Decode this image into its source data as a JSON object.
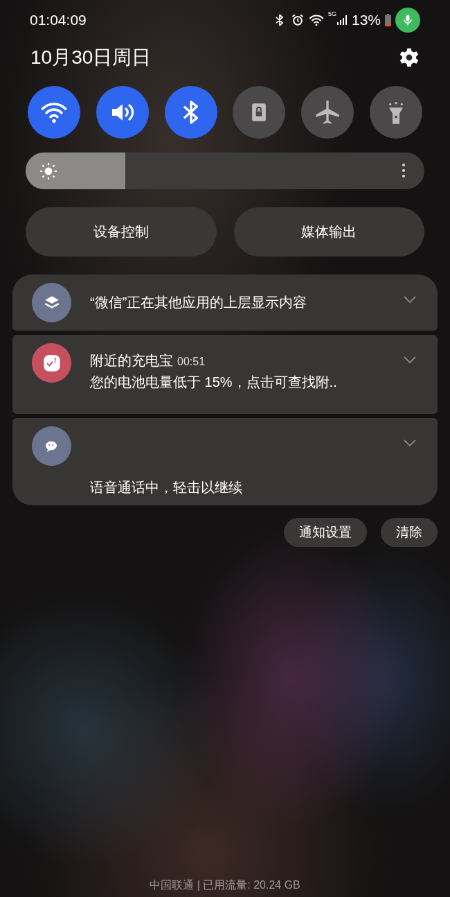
{
  "status_bar": {
    "time": "01:04:09",
    "network_badge": "5G",
    "battery": "13%"
  },
  "date": "10月30日周日",
  "toggles": [
    {
      "kind": "wifi",
      "on": true
    },
    {
      "kind": "sound",
      "on": true
    },
    {
      "kind": "bluetooth",
      "on": true
    },
    {
      "kind": "lock",
      "on": false
    },
    {
      "kind": "airplane",
      "on": false
    },
    {
      "kind": "flashlight",
      "on": false
    }
  ],
  "brightness": {
    "level": 0.25
  },
  "buttons": [
    "设备控制",
    "媒体输出"
  ],
  "notifications": [
    {
      "kind": "overlay",
      "title": "“微信”正在其他应用的上层显示内容"
    },
    {
      "kind": "battery",
      "title": "附近的充电宝",
      "time": "00:51",
      "text": "您的电池电量低于 15%，点击可查找附.."
    },
    {
      "kind": "call",
      "text": "语音通话中，轻击以继续"
    }
  ],
  "notification_actions": [
    "通知设置",
    "清除"
  ],
  "footer": "中国联通 | 已用流量: 20.24 GB"
}
